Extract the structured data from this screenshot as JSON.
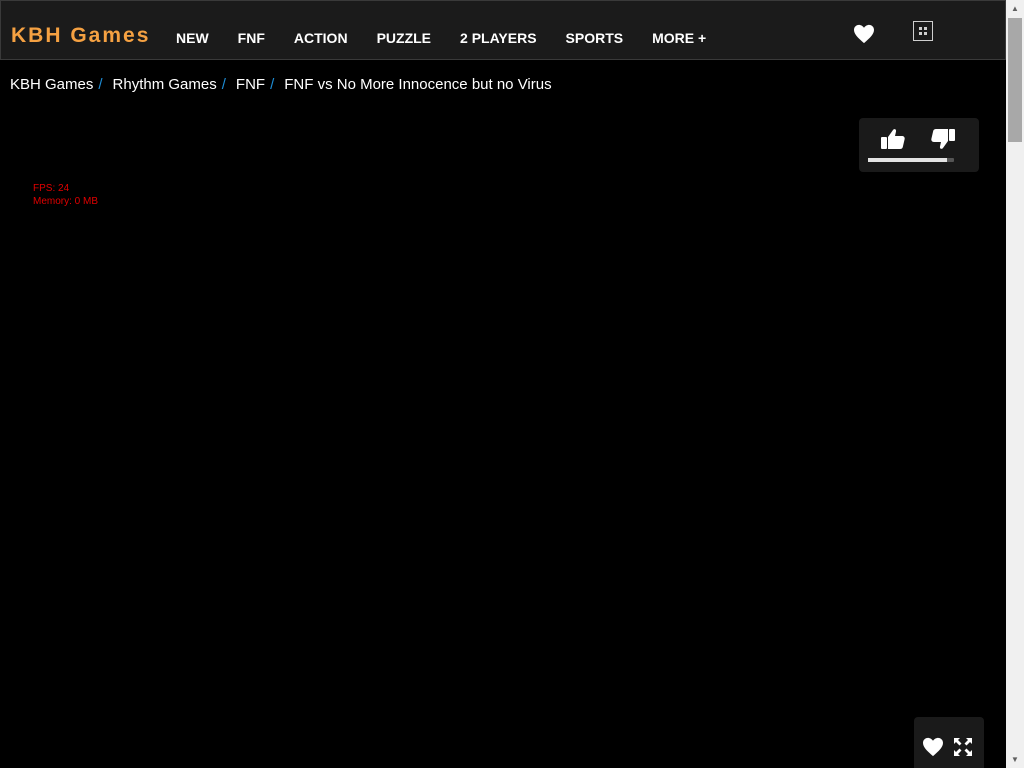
{
  "header": {
    "logo": "KBH Games",
    "nav_links": [
      "NEW",
      "FNF",
      "ACTION",
      "PUZZLE",
      "2 PLAYERS",
      "SPORTS",
      "MORE +"
    ],
    "icons": [
      "heart-icon",
      "grid-icon"
    ]
  },
  "breadcrumb": {
    "items": [
      "KBH Games",
      "Rhythm Games",
      "FNF",
      "FNF vs No More Innocence but no Virus"
    ],
    "separator": "/"
  },
  "rating": {
    "icons": [
      "thumbs-up-icon",
      "thumbs-down-icon"
    ],
    "like_fraction": 0.92
  },
  "debug": {
    "fps": "FPS: 24",
    "memory": "Memory: 0 MB"
  },
  "game_controls": {
    "icons": [
      "heart-icon",
      "fullscreen-icon"
    ]
  },
  "colors": {
    "background": "#000000",
    "navbar_bg": "#1b1b1b",
    "logo": "#f5a142",
    "breadcrumb_separator": "#1d8dd6",
    "debug_text": "#e00000",
    "panel_bg": "#1a1a1a"
  }
}
